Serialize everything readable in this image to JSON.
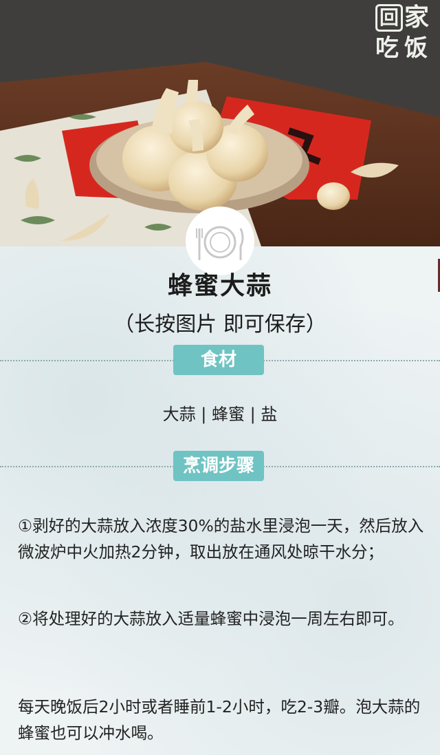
{
  "logo": {
    "c1": "回",
    "c2": "家",
    "c3": "吃",
    "c4": "饭"
  },
  "recipe": {
    "title": "蜂蜜大蒜",
    "subtitle": "（长按图片  即可保存）"
  },
  "sections": {
    "ingredients_label": "食材",
    "steps_label": "烹调步骤"
  },
  "ingredients": "大蒜 | 蜂蜜 | 盐",
  "steps": [
    "①剥好的大蒜放入浓度30%的盐水里浸泡一天，然后放入微波炉中火加热2分钟，取出放在通风处晾干水分；",
    "②将处理好的大蒜放入适量蜂蜜中浸泡一周左右即可。"
  ],
  "tip": "每天晚饭后2小时或者睡前1-2小时，吃2-3瓣。泡大蒜的蜂蜜也可以冲水喝。",
  "colors": {
    "accent": "#6fc3c3",
    "background": "#eef3f4",
    "text": "#222222"
  }
}
